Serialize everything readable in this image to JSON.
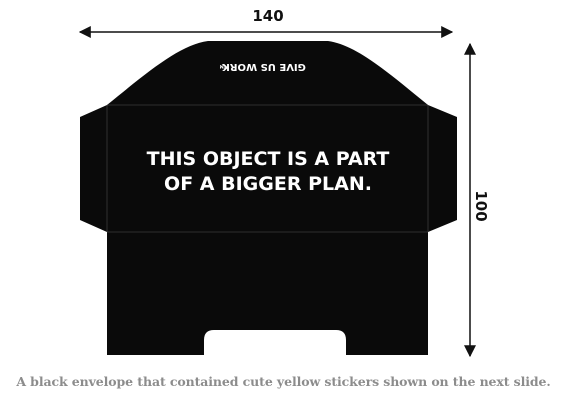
{
  "dimensions": {
    "width_label": "140",
    "height_label": "100"
  },
  "envelope": {
    "main_text_line1": "THIS OBJECT IS A PART",
    "main_text_line2": "OF A BIGGER PLAN.",
    "flap_text": "GIVE US WORK",
    "flap_logo_text": "TM"
  },
  "caption": "A black envelope that contained cute yellow stickers shown on the next slide.",
  "colors": {
    "envelope": "#0a0a0a",
    "dimension_lines": "#111111",
    "envelope_text": "#ffffff",
    "fold_lines": "#3a3a3a",
    "caption": "#8c8c8c"
  }
}
